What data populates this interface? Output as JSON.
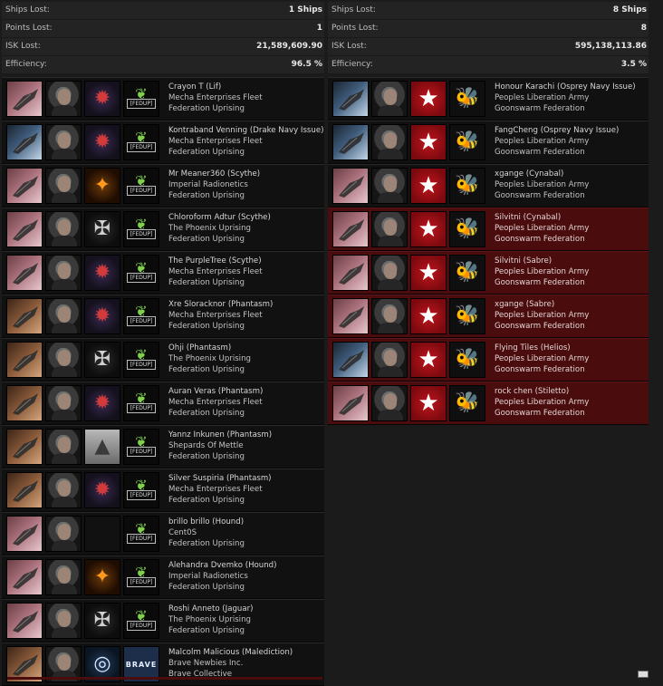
{
  "left": {
    "stats": [
      {
        "label": "Ships Lost:",
        "value": "1 Ships"
      },
      {
        "label": "Points Lost:",
        "value": "1"
      },
      {
        "label": "ISK Lost:",
        "value": "21,589,609.90"
      },
      {
        "label": "Efficiency:",
        "value": "96.5 %"
      }
    ],
    "kills": [
      {
        "pilot": "Crayon T (Lif)",
        "corp": "Mecha Enterprises Fleet",
        "alliance": "Federation Uprising",
        "ship_style": "pink",
        "corp_icon": "red-mech-logo-icon",
        "alli_icon": "fedup-logo-icon"
      },
      {
        "pilot": "Kontraband Venning (Drake Navy Issue)",
        "corp": "Mecha Enterprises Fleet",
        "alliance": "Federation Uprising",
        "ship_style": "blue",
        "corp_icon": "red-mech-logo-icon",
        "alli_icon": "fedup-logo-icon"
      },
      {
        "pilot": "Mr Meaner360 (Scythe)",
        "corp": "Imperial Radionetics",
        "alliance": "Federation Uprising",
        "ship_style": "pink",
        "corp_icon": "phoenix-logo-icon",
        "alli_icon": "fedup-logo-icon"
      },
      {
        "pilot": "Chloroform Adtur (Scythe)",
        "corp": "The Phoenix Uprising",
        "alliance": "Federation Uprising",
        "ship_style": "pink",
        "corp_icon": "winged-logo-icon",
        "alli_icon": "fedup-logo-icon"
      },
      {
        "pilot": "The PurpleTree (Scythe)",
        "corp": "Mecha Enterprises Fleet",
        "alliance": "Federation Uprising",
        "ship_style": "pink",
        "corp_icon": "red-mech-logo-icon",
        "alli_icon": "fedup-logo-icon"
      },
      {
        "pilot": "Xre Sloracknor (Phantasm)",
        "corp": "Mecha Enterprises Fleet",
        "alliance": "Federation Uprising",
        "ship_style": "tan",
        "corp_icon": "red-mech-logo-icon",
        "alli_icon": "fedup-logo-icon"
      },
      {
        "pilot": "Ohji (Phantasm)",
        "corp": "The Phoenix Uprising",
        "alliance": "Federation Uprising",
        "ship_style": "tan",
        "corp_icon": "winged-logo-icon",
        "alli_icon": "fedup-logo-icon"
      },
      {
        "pilot": "Auran Veras (Phantasm)",
        "corp": "Mecha Enterprises Fleet",
        "alliance": "Federation Uprising",
        "ship_style": "tan",
        "corp_icon": "red-mech-logo-icon",
        "alli_icon": "fedup-logo-icon"
      },
      {
        "pilot": "Yannz Inkunen (Phantasm)",
        "corp": "Shepards Of Mettle",
        "alliance": "Federation Uprising",
        "ship_style": "tan",
        "corp_icon": "grey-ship-logo-icon",
        "alli_icon": "fedup-logo-icon"
      },
      {
        "pilot": "Silver Suspiria (Phantasm)",
        "corp": "Mecha Enterprises Fleet",
        "alliance": "Federation Uprising",
        "ship_style": "tan",
        "corp_icon": "red-mech-logo-icon",
        "alli_icon": "fedup-logo-icon"
      },
      {
        "pilot": "brillo brillo (Hound)",
        "corp": "Cent0S",
        "alliance": "Federation Uprising",
        "ship_style": "pink",
        "corp_icon": "blank-logo-icon",
        "alli_icon": "fedup-logo-icon"
      },
      {
        "pilot": "Alehandra Dvemko (Hound)",
        "corp": "Imperial Radionetics",
        "alliance": "Federation Uprising",
        "ship_style": "pink",
        "corp_icon": "phoenix-logo-icon",
        "alli_icon": "fedup-logo-icon"
      },
      {
        "pilot": "Roshi Anneto (Jaguar)",
        "corp": "The Phoenix Uprising",
        "alliance": "Federation Uprising",
        "ship_style": "pink",
        "corp_icon": "winged-logo-icon",
        "alli_icon": "fedup-logo-icon"
      },
      {
        "pilot": "Malcolm Malicious (Malediction)",
        "corp": "Brave Newbies Inc.",
        "alliance": "Brave Collective",
        "ship_style": "tan",
        "corp_icon": "target-logo-icon",
        "alli_icon": "brave-logo-icon",
        "alli_text": "BRAVE"
      }
    ]
  },
  "right": {
    "stats": [
      {
        "label": "Ships Lost:",
        "value": "8 Ships"
      },
      {
        "label": "Points Lost:",
        "value": "8"
      },
      {
        "label": "ISK Lost:",
        "value": "595,138,113.86"
      },
      {
        "label": "Efficiency:",
        "value": "3.5 %"
      }
    ],
    "kills": [
      {
        "pilot": "Honour Karachi (Osprey Navy Issue)",
        "corp": "Peoples Liberation Army",
        "alliance": "Goonswarm Federation",
        "ship_style": "blue",
        "red": false
      },
      {
        "pilot": "FangCheng (Osprey Navy Issue)",
        "corp": "Peoples Liberation Army",
        "alliance": "Goonswarm Federation",
        "ship_style": "blue",
        "red": false
      },
      {
        "pilot": "xgange (Cynabal)",
        "corp": "Peoples Liberation Army",
        "alliance": "Goonswarm Federation",
        "ship_style": "pink",
        "red": false
      },
      {
        "pilot": "Silvitni (Cynabal)",
        "corp": "Peoples Liberation Army",
        "alliance": "Goonswarm Federation",
        "ship_style": "pink",
        "red": true
      },
      {
        "pilot": "Silvitni (Sabre)",
        "corp": "Peoples Liberation Army",
        "alliance": "Goonswarm Federation",
        "ship_style": "pink",
        "red": true
      },
      {
        "pilot": "xgange (Sabre)",
        "corp": "Peoples Liberation Army",
        "alliance": "Goonswarm Federation",
        "ship_style": "pink",
        "red": true
      },
      {
        "pilot": "Flying Tiles (Helios)",
        "corp": "Peoples Liberation Army",
        "alliance": "Goonswarm Federation",
        "ship_style": "blue",
        "red": true
      },
      {
        "pilot": "rock chen (Stiletto)",
        "corp": "Peoples Liberation Army",
        "alliance": "Goonswarm Federation",
        "ship_style": "pink",
        "red": true
      }
    ]
  },
  "icons": {
    "fed_text": "[FEDUP]",
    "star": "★",
    "bee": "🐝"
  }
}
